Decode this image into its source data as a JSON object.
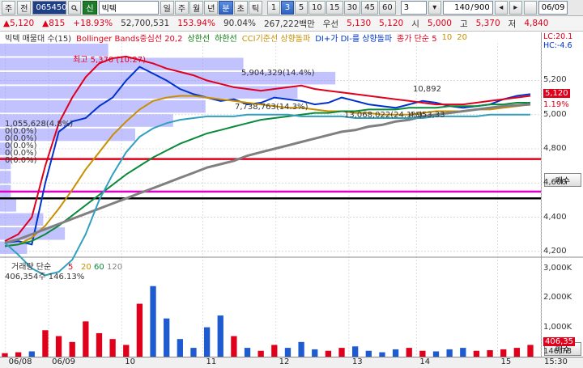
{
  "toolbar": {
    "menu1": "주",
    "menu2": "전",
    "code": "065450",
    "search_icon": "magnifier-icon",
    "market_tag": "신",
    "stock_name": "빅텍",
    "periods": [
      "일",
      "주",
      "월",
      "년",
      "분",
      "초",
      "틱"
    ],
    "active_period": "분",
    "minutes": [
      "1",
      "3",
      "5",
      "10",
      "15",
      "30",
      "45",
      "60"
    ],
    "active_minute": "3",
    "interval_value": "3",
    "count": "140",
    "count_total": "900",
    "date": "06/09"
  },
  "quote": {
    "price": "5,120",
    "change": "815",
    "change_pct": "+18.93%",
    "volume": "52,700,531",
    "ratio1": "153.94%",
    "ratio2": "90.04%",
    "amount": "267,222백만",
    "pref_label": "우선",
    "pref_price": "5,130",
    "ask": "5,120",
    "open_label": "시",
    "open": "5,000",
    "high_label": "고",
    "high": "5,370",
    "low_label": "저",
    "low": "4,840"
  },
  "legend": {
    "items": [
      {
        "text": "빅텍 매물대 수(15)",
        "color": "#333333"
      },
      {
        "text": "Bollinger Bands중심선 20,2",
        "color": "#e0001b"
      },
      {
        "text": "상한선",
        "color": "#0a7a0a"
      },
      {
        "text": "하한선",
        "color": "#0a7a0a"
      },
      {
        "text": "CCI기준선 상향돌파",
        "color": "#c89000"
      },
      {
        "text": "DI+가 DI-를 상향돌파",
        "color": "#0033cc"
      },
      {
        "text": "종가 단순 5",
        "color": "#e0001b"
      },
      {
        "text": "10",
        "color": "#c89000"
      },
      {
        "text": "20",
        "color": "#c89000"
      }
    ],
    "right_top": "LC:20.1",
    "right_second": "HC:-4.6"
  },
  "volume_legend": {
    "title": "거래량",
    "ma_label": "단순",
    "mas": [
      "5",
      "20",
      "60",
      "120"
    ],
    "value": "406,354주",
    "value_pct": "146.13%"
  },
  "chart_data": {
    "type": "line",
    "title": "빅텍",
    "yticks": [
      4200,
      4400,
      4600,
      4800,
      5000,
      5200
    ],
    "ylim": [
      4180,
      5420
    ],
    "volume_ticks": [
      "3,000K",
      "2,000K",
      "1,000K"
    ],
    "volume_ylim": [
      0,
      3300
    ],
    "last_price": 5120,
    "last_volume_label": "406,35",
    "last_volume_label2": "146,78",
    "current_pct": "1.19%",
    "xlabels": [
      {
        "label": "06/08",
        "pos": 0.01
      },
      {
        "label": "06/09",
        "pos": 0.09
      },
      {
        "label": "10",
        "pos": 0.225
      },
      {
        "label": "11",
        "pos": 0.375
      },
      {
        "label": "12",
        "pos": 0.51
      },
      {
        "label": "13",
        "pos": 0.645
      },
      {
        "label": "14",
        "pos": 0.77
      },
      {
        "label": "15",
        "pos": 0.92
      },
      {
        "label": "15:30",
        "pos": 1.0
      }
    ],
    "annotations": [
      {
        "text": "최고 5,370 (10:27)",
        "color": "#e0001b"
      },
      {
        "text": "1,055,628(4.8%)",
        "color": "#333333"
      },
      {
        "text": "0(0.0%)",
        "color": "#333333"
      },
      {
        "text": "0(0.0%)",
        "color": "#333333"
      },
      {
        "text": "0(0.0%)",
        "color": "#333333"
      },
      {
        "text": "0(0.0%)",
        "color": "#333333"
      },
      {
        "text": "0(0.0%)",
        "color": "#333333"
      },
      {
        "text": "13,068,022(24.1%)",
        "color": "#333333"
      },
      {
        "text": "7,738,763(14.3%)",
        "color": "#333333"
      },
      {
        "text": "4,953,33",
        "color": "#333333"
      },
      {
        "text": "5,904,329(14.4%)",
        "color": "#333333"
      },
      {
        "text": "10,892",
        "color": "#333333"
      }
    ],
    "profile_bars": [
      0.05,
      0.12,
      0.08,
      0.03,
      0.02,
      0.02,
      0.02,
      0.02,
      0.25,
      0.32,
      0.38,
      0.55,
      0.62,
      0.45,
      0.2
    ],
    "series": [
      {
        "name": "종가",
        "color": "#0033cc",
        "values": [
          4250,
          4260,
          4240,
          4600,
          4900,
          4960,
          4980,
          5050,
          5100,
          5200,
          5280,
          5240,
          5200,
          5150,
          5120,
          5100,
          5080,
          5090,
          5060,
          5070,
          5100,
          5090,
          5080,
          5060,
          5070,
          5100,
          5080,
          5060,
          5050,
          5040,
          5060,
          5080,
          5070,
          5050,
          5040,
          5050,
          5060,
          5090,
          5110,
          5120
        ]
      },
      {
        "name": "5",
        "color": "#e0001b",
        "values": [
          4260,
          4300,
          4400,
          4700,
          4950,
          5100,
          5220,
          5300,
          5330,
          5340,
          5320,
          5300,
          5270,
          5250,
          5230,
          5200,
          5180,
          5160,
          5150,
          5140,
          5150,
          5160,
          5170,
          5150,
          5140,
          5130,
          5120,
          5110,
          5100,
          5090,
          5080,
          5070,
          5060,
          5060,
          5060,
          5070,
          5080,
          5090,
          5100,
          5110
        ]
      },
      {
        "name": "20",
        "color": "#c89000",
        "values": [
          4230,
          4240,
          4280,
          4350,
          4450,
          4560,
          4680,
          4780,
          4880,
          4960,
          5030,
          5080,
          5100,
          5110,
          5110,
          5100,
          5090,
          5080,
          5070,
          5060,
          5050,
          5040,
          5040,
          5030,
          5020,
          5020,
          5010,
          5010,
          5000,
          5000,
          5000,
          5010,
          5020,
          5020,
          5020,
          5030,
          5030,
          5040,
          5050,
          5060
        ]
      },
      {
        "name": "60",
        "color": "#0a8a3a",
        "values": [
          4230,
          4240,
          4260,
          4300,
          4350,
          4410,
          4470,
          4530,
          4590,
          4650,
          4700,
          4750,
          4790,
          4830,
          4860,
          4890,
          4910,
          4930,
          4950,
          4970,
          4980,
          4990,
          5000,
          5010,
          5010,
          5020,
          5020,
          5030,
          5030,
          5030,
          5040,
          5040,
          5040,
          5050,
          5050,
          5050,
          5060,
          5060,
          5070,
          5070
        ]
      },
      {
        "name": "120",
        "color": "#808080",
        "values": [
          4250,
          4270,
          4300,
          4330,
          4360,
          4390,
          4420,
          4450,
          4480,
          4510,
          4540,
          4570,
          4600,
          4630,
          4660,
          4690,
          4710,
          4730,
          4760,
          4780,
          4800,
          4820,
          4840,
          4860,
          4880,
          4900,
          4910,
          4930,
          4940,
          4960,
          4970,
          4990,
          5000,
          5010,
          5020,
          5030,
          5040,
          5050,
          5055,
          5060
        ]
      },
      {
        "name": "하한선",
        "color": "#30a0c0",
        "values": [
          4250,
          4180,
          4100,
          4060,
          4080,
          4150,
          4300,
          4500,
          4650,
          4780,
          4870,
          4920,
          4950,
          4970,
          4980,
          4990,
          4990,
          4990,
          5000,
          5000,
          5000,
          5000,
          4990,
          4990,
          4990,
          4990,
          4980,
          4980,
          4980,
          4980,
          4980,
          4980,
          4990,
          4990,
          4990,
          4990,
          5000,
          5000,
          5000,
          5000
        ]
      }
    ],
    "volume": [
      120,
      150,
      180,
      900,
      700,
      500,
      1200,
      800,
      600,
      400,
      1800,
      2400,
      1300,
      600,
      300,
      1000,
      1400,
      700,
      300,
      200,
      400,
      300,
      500,
      250,
      200,
      300,
      350,
      200,
      150,
      250,
      300,
      200,
      180,
      250,
      300,
      200,
      220,
      250,
      300,
      400
    ],
    "volume_color_up": "#e0001b",
    "volume_color_down": "#1f5bd0",
    "hlines": [
      {
        "value": 4740,
        "color": "#e0001b"
      },
      {
        "value": 4550,
        "color": "#e000c8"
      },
      {
        "value": 4510,
        "color": "#000000"
      }
    ]
  },
  "side_buttons": {
    "buy_top": "매수",
    "buy_bottom": "매수"
  }
}
